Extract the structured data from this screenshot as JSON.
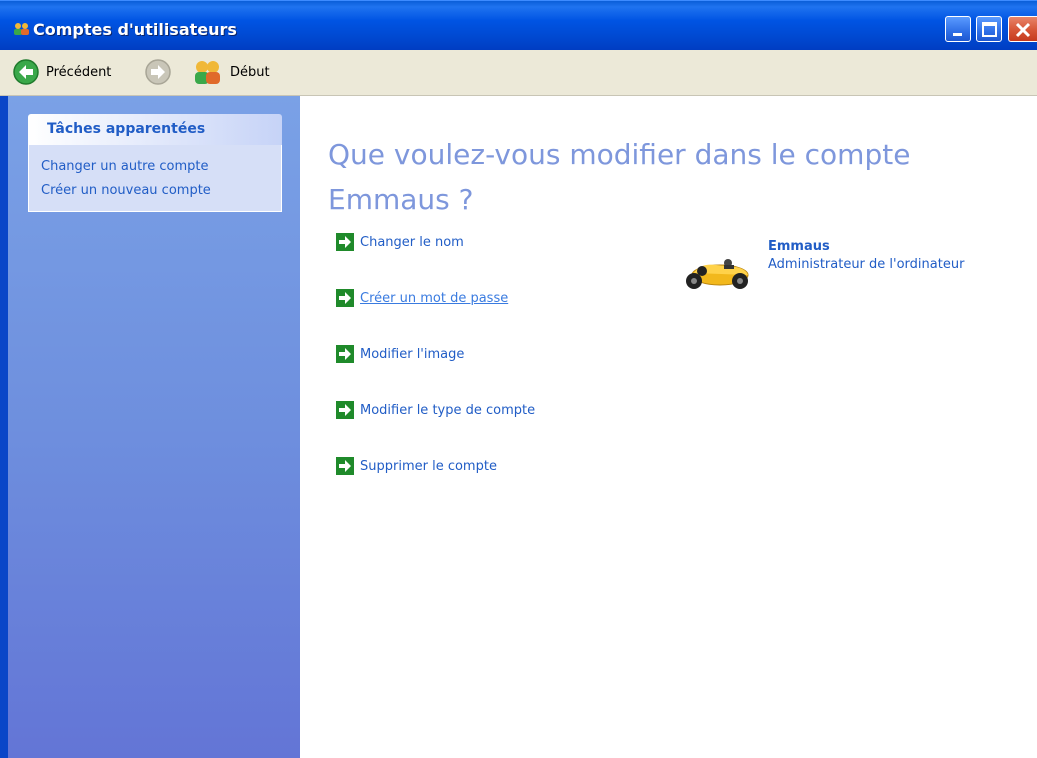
{
  "window": {
    "title": "Comptes d'utilisateurs",
    "controls": [
      "minimize-icon",
      "maximize-icon",
      "close-icon"
    ]
  },
  "toolbar": {
    "back_label": "Précédent",
    "home_label": "Début"
  },
  "sidebar": {
    "taskbox_title": "Tâches apparentées",
    "links": [
      {
        "label": "Changer un autre compte"
      },
      {
        "label": "Créer un nouveau compte"
      }
    ]
  },
  "main": {
    "title": "Que voulez-vous modifier dans le compte Emmaus ?",
    "actions": [
      {
        "label": "Changer le nom",
        "icon": "green-arrow-icon"
      },
      {
        "label": "Créer un mot de passe",
        "icon": "green-arrow-icon",
        "state": "hover"
      },
      {
        "label": "Modifier l'image",
        "icon": "green-arrow-icon"
      },
      {
        "label": "Modifier le type de compte",
        "icon": "green-arrow-icon"
      },
      {
        "label": "Supprimer le compte",
        "icon": "green-arrow-icon"
      }
    ],
    "user": {
      "name": "Emmaus",
      "role": "Administrateur de l'ordinateur",
      "picture": "race-car-icon"
    }
  },
  "colors": {
    "titlebar": "#0054e3",
    "sidebar_top": "#7aa1e6",
    "sidebar_bottom": "#6375d6",
    "link": "#215dc6",
    "heading": "#7e97dc",
    "toolbar": "#ece9d8"
  }
}
